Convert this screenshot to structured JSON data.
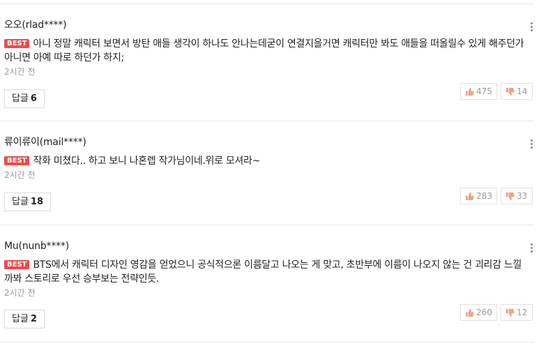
{
  "badge": "BEST",
  "reply_label": "답글",
  "comments": [
    {
      "author": "오오(rlad****)",
      "text": "아니 정말 캐릭터 보면서 방탄 애들 생각이 하나도 안나는데굳이 연결지을거면 캐릭터만 봐도 애들을 떠올릴수 있게 해주던가 아니면 아예 따로 하던가 하지;",
      "time": "2시간 전",
      "replies": "6",
      "likes": "475",
      "dislikes": "14"
    },
    {
      "author": "류이류이(mail****)",
      "text": "작화 미쳤다.. 하고 보니 나혼렙 작가님이네.위로 모셔라~",
      "time": "2시간 전",
      "replies": "18",
      "likes": "283",
      "dislikes": "33"
    },
    {
      "author": "Mu(nunb****)",
      "text": "BTS에서 캐릭터 디자인 영감을 얻었으니 공식적으론 이름달고 나오는 게 맞고, 초반부에 이름이 나오지 않는 건 괴리감 느낄까봐 스토리로 우선 승부보는 전략인듯.",
      "time": "2시간 전",
      "replies": "2",
      "likes": "260",
      "dislikes": "12"
    }
  ],
  "colors": {
    "best_badge": "#f04a4a",
    "thumb_up": "#e8a58a",
    "thumb_down": "#e8a58a",
    "divider": "#e6e6e6"
  }
}
